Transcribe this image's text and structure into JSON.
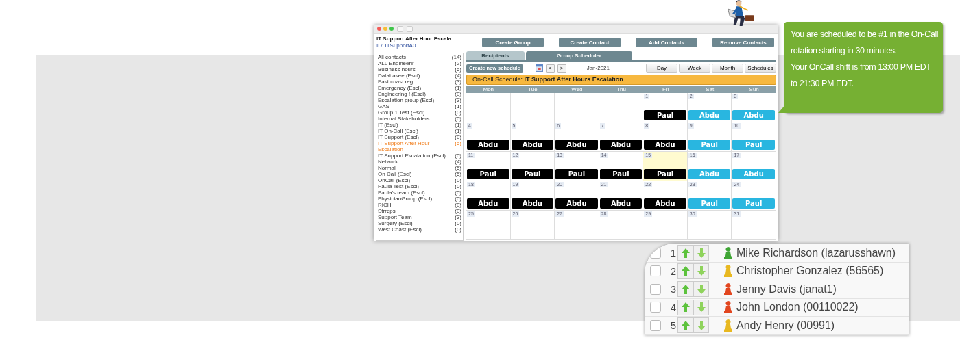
{
  "app_window": {
    "title": "IT Support After Hour Escala...",
    "id_label": "ID: ITSupportA0",
    "actions": [
      "Create Group",
      "Create Contact",
      "Add Contacts",
      "Remove Contacts"
    ],
    "tabs": [
      {
        "label": "Recipients",
        "selected": false
      },
      {
        "label": "Group Scheduler",
        "selected": true
      }
    ],
    "groups": [
      {
        "name": "All contacts",
        "count": "(14)",
        "selected": false
      },
      {
        "name": "ALL Engineerlr",
        "count": "(2)",
        "selected": false
      },
      {
        "name": "Business hours",
        "count": "(5)",
        "selected": false
      },
      {
        "name": "Databasee (Escl)",
        "count": "(4)",
        "selected": false
      },
      {
        "name": "East coast reg.",
        "count": "(3)",
        "selected": false
      },
      {
        "name": "Emergency (Escl)",
        "count": "(1)",
        "selected": false
      },
      {
        "name": "Engineering ! (Escl)",
        "count": "(0)",
        "selected": false
      },
      {
        "name": "Escalation group (Escl)",
        "count": "(3)",
        "selected": false
      },
      {
        "name": "GAS",
        "count": "(1)",
        "selected": false
      },
      {
        "name": "Group 1 Test (Escl)",
        "count": "(0)",
        "selected": false
      },
      {
        "name": "Internal Stakeholders",
        "count": "(0)",
        "selected": false
      },
      {
        "name": "IT (Escl)",
        "count": "(1)",
        "selected": false
      },
      {
        "name": "IT On-Call (Escl)",
        "count": "(1)",
        "selected": false
      },
      {
        "name": "IT Support (Escl)",
        "count": "(0)",
        "selected": false
      },
      {
        "name": "IT Support After Hour Escalation",
        "count": "(5)",
        "selected": true
      },
      {
        "name": "IT Support Escalation (Escl)",
        "count": "(0)",
        "selected": false
      },
      {
        "name": "Network",
        "count": "(4)",
        "selected": false
      },
      {
        "name": "Normal",
        "count": "(5)",
        "selected": false
      },
      {
        "name": "On Call (Escl)",
        "count": "(5)",
        "selected": false
      },
      {
        "name": "OnCall (Escl)",
        "count": "(0)",
        "selected": false
      },
      {
        "name": "Paula Test (Escl)",
        "count": "(0)",
        "selected": false
      },
      {
        "name": "Paula's team (Escl)",
        "count": "(0)",
        "selected": false
      },
      {
        "name": "PhysicianGroup (Escl)",
        "count": "(0)",
        "selected": false
      },
      {
        "name": "RICH",
        "count": "(0)",
        "selected": false
      },
      {
        "name": "Strreps",
        "count": "(0)",
        "selected": false
      },
      {
        "name": "Support Team",
        "count": "(3)",
        "selected": false
      },
      {
        "name": "Surgery (Escl)",
        "count": "(0)",
        "selected": false
      },
      {
        "name": "West Coast (Escl)",
        "count": "(0)",
        "selected": false
      }
    ],
    "toolbar": {
      "create_button": "Create new schedule",
      "prev": "<",
      "next": ">",
      "month": "Jan-2021",
      "views": [
        "Day",
        "Week",
        "Month",
        "Schedules"
      ]
    },
    "banner": "On-Call Schedule: **IT Support After Hours Escalation**",
    "weekdays": [
      "Mon",
      "Tue",
      "Wed",
      "Thu",
      "Fri",
      "Sat",
      "Sun"
    ],
    "weeks": [
      [
        {
          "date": "1",
          "today": false,
          "event": {
            "name": "Paul",
            "color": "#000000"
          }
        },
        {
          "date": "2",
          "today": false,
          "event": {
            "name": "Abdu",
            "color": "#29b6e0"
          }
        },
        {
          "date": "3",
          "today": false,
          "event": {
            "name": "Abdu",
            "color": "#29b6e0"
          }
        }
      ],
      [
        {
          "date": "4",
          "today": false,
          "event": {
            "name": "Abdu",
            "color": "#000000"
          }
        },
        {
          "date": "5",
          "today": false,
          "event": {
            "name": "Abdu",
            "color": "#000000"
          }
        },
        {
          "date": "6",
          "today": false,
          "event": {
            "name": "Abdu",
            "color": "#000000"
          }
        },
        {
          "date": "7",
          "today": false,
          "event": {
            "name": "Abdu",
            "color": "#000000"
          }
        },
        {
          "date": "8",
          "today": false,
          "event": {
            "name": "Abdu",
            "color": "#000000"
          }
        },
        {
          "date": "9",
          "today": false,
          "event": {
            "name": "Paul",
            "color": "#29b6e0"
          }
        },
        {
          "date": "10",
          "today": false,
          "event": {
            "name": "Paul",
            "color": "#29b6e0"
          }
        }
      ],
      [
        {
          "date": "11",
          "today": false,
          "event": {
            "name": "Paul",
            "color": "#000000"
          }
        },
        {
          "date": "12",
          "today": false,
          "event": {
            "name": "Paul",
            "color": "#000000"
          }
        },
        {
          "date": "13",
          "today": false,
          "event": {
            "name": "Paul",
            "color": "#000000"
          }
        },
        {
          "date": "14",
          "today": false,
          "event": {
            "name": "Paul",
            "color": "#000000"
          }
        },
        {
          "date": "15",
          "today": true,
          "event": {
            "name": "Paul",
            "color": "#000000"
          }
        },
        {
          "date": "16",
          "today": false,
          "event": {
            "name": "Abdu",
            "color": "#29b6e0"
          }
        },
        {
          "date": "17",
          "today": false,
          "event": {
            "name": "Abdu",
            "color": "#29b6e0"
          }
        }
      ],
      [
        {
          "date": "18",
          "today": false,
          "event": {
            "name": "Abdu",
            "color": "#000000"
          }
        },
        {
          "date": "19",
          "today": false,
          "event": {
            "name": "Abdu",
            "color": "#000000"
          }
        },
        {
          "date": "20",
          "today": false,
          "event": {
            "name": "Abdu",
            "color": "#000000"
          }
        },
        {
          "date": "21",
          "today": false,
          "event": {
            "name": "Abdu",
            "color": "#000000"
          }
        },
        {
          "date": "22",
          "today": false,
          "event": {
            "name": "Abdu",
            "color": "#000000"
          }
        },
        {
          "date": "23",
          "today": false,
          "event": {
            "name": "Paul",
            "color": "#29b6e0"
          }
        },
        {
          "date": "24",
          "today": false,
          "event": {
            "name": "Paul",
            "color": "#29b6e0"
          }
        }
      ],
      [
        {
          "date": "25",
          "today": false
        },
        {
          "date": "26",
          "today": false
        },
        {
          "date": "27",
          "today": false
        },
        {
          "date": "28",
          "today": false
        },
        {
          "date": "29",
          "today": false
        },
        {
          "date": "30",
          "today": false
        },
        {
          "date": "31",
          "today": false
        }
      ]
    ]
  },
  "notification": [
    "You are scheduled to be #1 in the On-Call rotation starting in 30 minutes.",
    "Your OnCall shift is from 13:00 PM EDT to 21:30 PM EDT."
  ],
  "rotation": [
    {
      "rank": "1",
      "name": "Mike Richardson (lazarusshawn)",
      "color": "#3fa535",
      "checked": false
    },
    {
      "rank": "2",
      "name": "Christopher Gonzalez (56565)",
      "color": "#e8b820",
      "checked": false
    },
    {
      "rank": "3",
      "name": "Jenny Davis (janat1)",
      "color": "#e2461f",
      "checked": false
    },
    {
      "rank": "4",
      "name": "John London (00110022)",
      "color": "#e2461f",
      "checked": false
    },
    {
      "rank": "5",
      "name": "Andy Henry (00991)",
      "color": "#e8b820",
      "checked": false
    }
  ]
}
